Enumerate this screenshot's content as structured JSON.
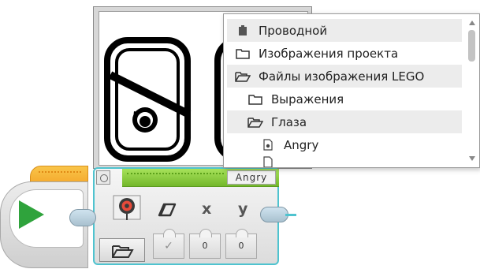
{
  "display_block": {
    "image_name_label": "Angry",
    "params": {
      "erase_icon": "eraser-icon",
      "x_label": "x",
      "y_label": "y",
      "erase_value": "✓",
      "x_value": "0",
      "y_value": "0"
    },
    "mode_icon": "display-image-mode-icon",
    "file_button_icon": "folder-open-icon"
  },
  "start_block": {
    "icon": "play-icon"
  },
  "file_browser": {
    "items": [
      {
        "label": "Проводной",
        "icon": "device-icon",
        "level": 0
      },
      {
        "label": "Изображения проекта",
        "icon": "folder-icon",
        "level": 0
      },
      {
        "label": "Файлы изображения LEGO",
        "icon": "folder-open-icon",
        "level": 0
      },
      {
        "label": "Выражения",
        "icon": "folder-icon",
        "level": 1
      },
      {
        "label": "Глаза",
        "icon": "folder-open-icon",
        "level": 1
      },
      {
        "label": "Angry",
        "icon": "image-file-icon",
        "level": 2
      }
    ],
    "selected_index": 5
  },
  "colors": {
    "start_block_accent": "#f4a62a",
    "display_block_accent": "#73b72b",
    "block_outline": "#4fc3cf",
    "play_icon": "#2fa33c"
  }
}
